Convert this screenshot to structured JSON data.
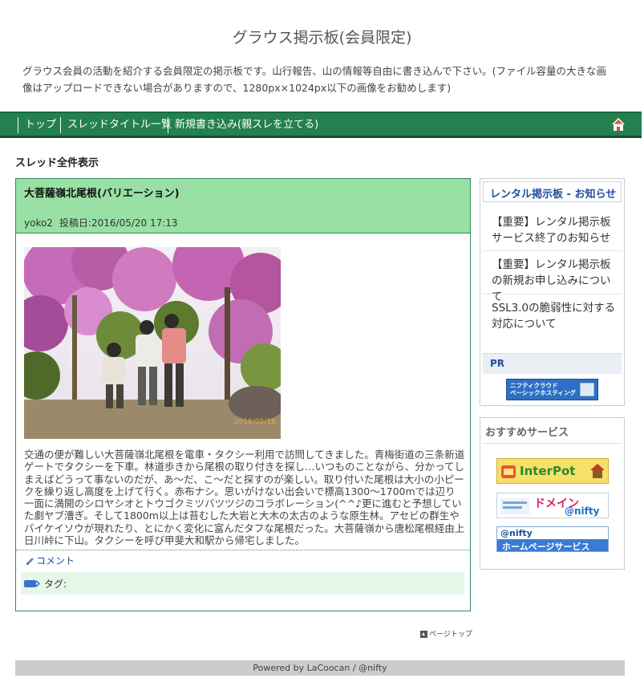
{
  "site": {
    "title": "グラウス掲示板(会員限定)",
    "description": "グラウス会員の活動を紹介する会員限定の掲示板です。山行報告、山の情報等自由に書き込んで下さい。(ファイル容量の大きな画像はアップロードできない場合がありますので、1280px×1024px以下の画像をお勧めします)"
  },
  "nav": {
    "items": [
      "トップ",
      "スレッドタイトル一覧",
      "新規書き込み(親スレを立てる)"
    ],
    "home_icon": "home-icon"
  },
  "page": {
    "heading": "スレッド全件表示"
  },
  "thread": {
    "title": "大菩薩嶺北尾根(バリエーション)",
    "author": "yoko2",
    "date_label": "投稿日:",
    "date": "2016/05/20 17:13",
    "photo_timestamp": "2016/05/18",
    "body": "交通の便が難しい大菩薩嶺北尾根を電車・タクシー利用で訪問してきました。青梅街道の三条新道ゲートでタクシーを下車。林道歩きから尾根の取り付きを探し…いつものことながら、分かってしまえばどうって事ないのだが、あ〜だ、こ〜だと探すのが楽しい。取り付いた尾根は大小の小ピークを繰り返し高度を上げて行く。赤布ナシ。思いがけない出会いで標高1300〜1700mでは辺り一面に満開のシロヤシオとトウゴクミツバツツジのコラボレーション(^^♪更に進むと予想していた劇ヤブ漕ぎ。そして1800m以上は苔むした大岩と大木の太古のような原生林。アセビの群生やバイケイソウが現れたり、とにかく変化に富んだタフな尾根だった。大菩薩嶺から唐松尾根経由上日川峠に下山。タクシーを呼び甲斐大和駅から帰宅しました。",
    "comment_label": "コメント",
    "tag_label": "タグ:"
  },
  "page_top_label": "ページトップ",
  "footer": "Powered by LaCoocan / @nifty",
  "sidebar": {
    "notice_heading": "レンタル掲示板 - お知らせ",
    "notices": [
      "【重要】レンタル掲示板サービス終了のお知らせ",
      "【重要】レンタル掲示板の新規お申し込みについて",
      "SSL3.0の脆弱性に対する対応について"
    ],
    "pr_heading": "PR",
    "pr_banner_line1": "ニフティクラウド",
    "pr_banner_line2": "ベーシックホスティング",
    "services_heading": "おすすめサービス",
    "services": [
      {
        "text": "InterPot",
        "sub": ""
      },
      {
        "text": "ドメイン",
        "sub": "@nifty"
      },
      {
        "text": "ホームページサービス",
        "sub": "@nifty"
      }
    ]
  },
  "colors": {
    "nav_bg": "#23804f",
    "thread_head_bg": "#98e0a3",
    "thread_border": "#2f8c5b",
    "link": "#1f4e9e"
  }
}
